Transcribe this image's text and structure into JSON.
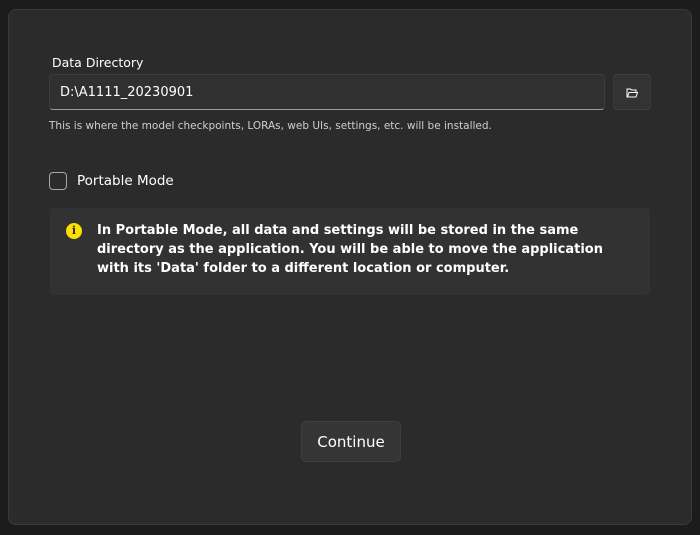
{
  "data_directory": {
    "label": "Data Directory",
    "value": "D:\\A1111_20230901",
    "browse_icon": "folder-open-icon",
    "help_text": "This is where the model checkpoints, LORAs, web UIs, settings, etc. will be installed."
  },
  "portable_mode": {
    "label": "Portable Mode",
    "checked": false
  },
  "info_bar": {
    "icon": "info-icon",
    "icon_color": "#fce100",
    "message": "In Portable Mode, all data and settings will be stored in the same directory as the application. You will be able to move the application with its 'Data' folder to a different location or computer."
  },
  "continue_button": {
    "label": "Continue"
  }
}
